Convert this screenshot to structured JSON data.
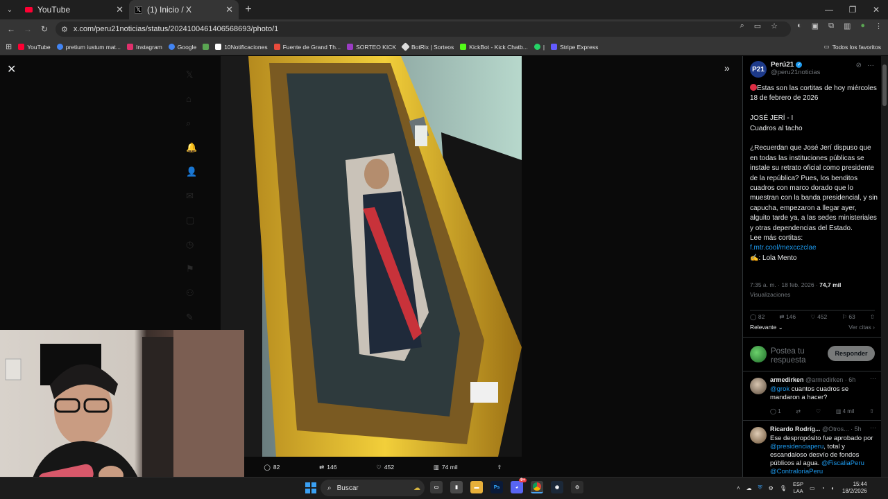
{
  "browser": {
    "tabs": [
      {
        "label": "YouTube",
        "icon": "youtube-icon"
      },
      {
        "label": "(1) Inicio / X",
        "icon": "x-logo-icon"
      }
    ],
    "url": "x.com/peru21noticias/status/2024100461406568693/photo/1",
    "bookmarks": [
      {
        "label": "YouTube",
        "color": "#ff0033"
      },
      {
        "label": "pretium iustum mat...",
        "color": "#4285f4"
      },
      {
        "label": "Instagram",
        "color": "#e1306c"
      },
      {
        "label": "Google",
        "color": "#4285f4"
      },
      {
        "label": "",
        "color": "#5aa552"
      },
      {
        "label": "10Notificaciones",
        "color": "#ffffff"
      },
      {
        "label": "Fuente de Grand Th...",
        "color": "#e94b3c"
      },
      {
        "label": "SORTEO KICK",
        "color": "#9b3cc4"
      },
      {
        "label": "BotRix | Sorteos",
        "color": "#dddddd"
      },
      {
        "label": "KickBot - Kick Chatb...",
        "color": "#53fc18"
      },
      {
        "label": "|",
        "color": "#25d366"
      },
      {
        "label": "Stripe Express",
        "color": "#635bff"
      }
    ],
    "all_bookmarks": "Todos los favoritos"
  },
  "photo_actions": {
    "replies": "82",
    "reposts": "146",
    "likes": "452",
    "views": "74 mil"
  },
  "post": {
    "author_name": "Perú21",
    "author_handle": "@peru21noticias",
    "avatar_text": "P21",
    "text_line1": "Estas son las cortitas de hoy miércoles 18 de febrero de 2026",
    "text_line2": "JOSÉ JERÍ - I",
    "text_line3": "Cuadros al tacho",
    "text_body": "¿Recuerdan que José Jerí dispuso que en todas las instituciones públicas se instale su retrato oficial como presidente de la república? Pues, los benditos cuadros con marco dorado que lo muestran con la banda presidencial, y sin capucha, empezaron a llegar ayer, alguito tarde ya, a las sedes ministeriales y otras dependencias del Estado.",
    "text_more": "Lee más cortitas:",
    "link": "f.mtr.cool/mexcczclae",
    "signature": "✍️: Lola Mento",
    "time": "7:35 a. m. · 18 feb. 2026 ·",
    "views": "74,7 mil",
    "views_label": "Visualizaciones",
    "stats": {
      "replies": "82",
      "reposts": "146",
      "likes": "452",
      "bookmarks": "63"
    },
    "sort_label": "Relevante",
    "quotes_label": "Ver citas",
    "reply_placeholder": "Postea tu respuesta",
    "reply_button": "Responder"
  },
  "replies": [
    {
      "name": "armedirken",
      "handle": "@armedirken · 6h",
      "mention": "@grok",
      "text": " cuantos cuadros se mandaron a hacer?",
      "replies": "1",
      "views": "4 mil"
    },
    {
      "name": "Ricardo Rodríg...",
      "handle": "@Otros... · 5h",
      "text_a": "Ese despropósito fue aprobado por ",
      "mention_a": "@presidenciaperu",
      "text_b": ", total y escandaloso desvío de fondos públicos al agua. ",
      "mention_b": "@FiscaliaPeru @ContraloriaPeru"
    }
  ],
  "taskbar": {
    "search_placeholder": "Buscar",
    "lang_top": "ESP",
    "lang_bottom": "LAA",
    "time": "15:44",
    "date": "18/2/2026",
    "discord_badge": "9+"
  }
}
